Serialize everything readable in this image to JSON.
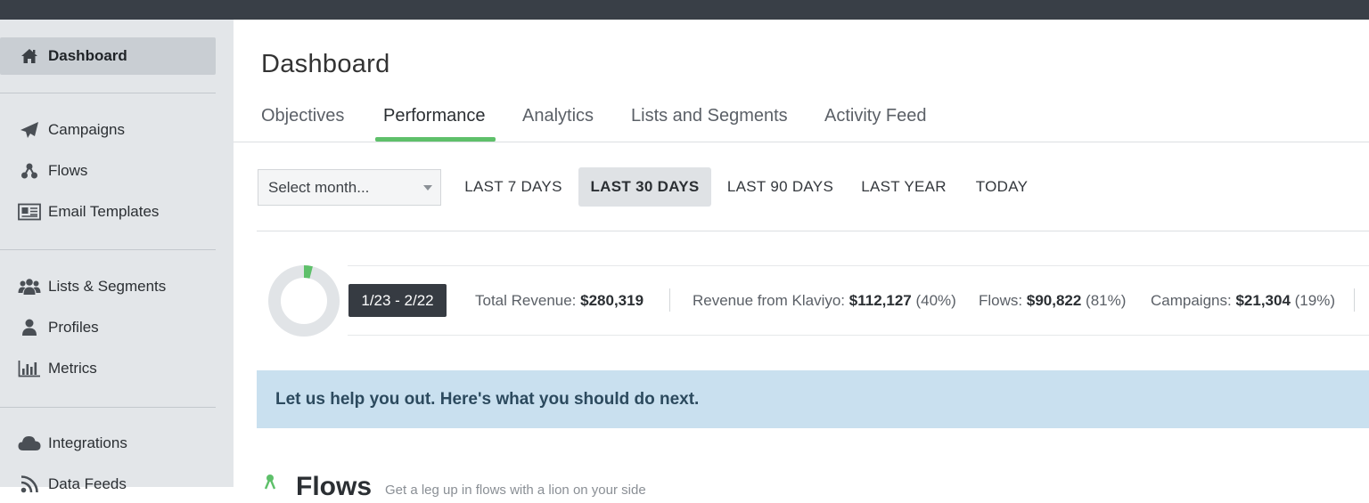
{
  "sidebar": {
    "items": [
      {
        "label": "Dashboard",
        "icon": "home-icon"
      },
      {
        "label": "Campaigns",
        "icon": "paper-plane-icon"
      },
      {
        "label": "Flows",
        "icon": "flow-icon"
      },
      {
        "label": "Email Templates",
        "icon": "newspaper-icon"
      },
      {
        "label": "Lists & Segments",
        "icon": "users-icon"
      },
      {
        "label": "Profiles",
        "icon": "user-icon"
      },
      {
        "label": "Metrics",
        "icon": "bar-chart-icon"
      },
      {
        "label": "Integrations",
        "icon": "cloud-icon"
      },
      {
        "label": "Data Feeds",
        "icon": "rss-icon"
      }
    ],
    "active": "Dashboard"
  },
  "main": {
    "title": "Dashboard",
    "tabs": [
      "Objectives",
      "Performance",
      "Analytics",
      "Lists and Segments",
      "Activity Feed"
    ],
    "active_tab": "Performance",
    "filters": {
      "month_placeholder": "Select month...",
      "ranges": [
        "LAST 7 DAYS",
        "LAST 30 DAYS",
        "LAST 90 DAYS",
        "LAST YEAR",
        "TODAY"
      ],
      "active_range": "LAST 30 DAYS"
    },
    "summary": {
      "date_range": "1/23 - 2/22",
      "klaviyo_share_fraction": 0.04,
      "total_revenue_label": "Total Revenue:",
      "total_revenue_value": "$280,319",
      "klaviyo_label": "Revenue from Klaviyo:",
      "klaviyo_value": "$112,127",
      "klaviyo_pct": "(40%)",
      "flows_label": "Flows:",
      "flows_value": "$90,822",
      "flows_pct": "(81%)",
      "campaigns_label": "Campaigns:",
      "campaigns_value": "$21,304",
      "campaigns_pct": "(19%)"
    },
    "help_banner": "Let us help you out. Here's what you should do next.",
    "flows_section": {
      "heading": "Flows",
      "subtitle": "Get a leg up in flows with a lion on your side"
    }
  },
  "colors": {
    "topbar": "#393f47",
    "sidebar_bg": "#e3e6e9",
    "accent_green": "#5ec06a",
    "banner_bg": "#c9e0ef",
    "chip_bg": "#363b42"
  }
}
